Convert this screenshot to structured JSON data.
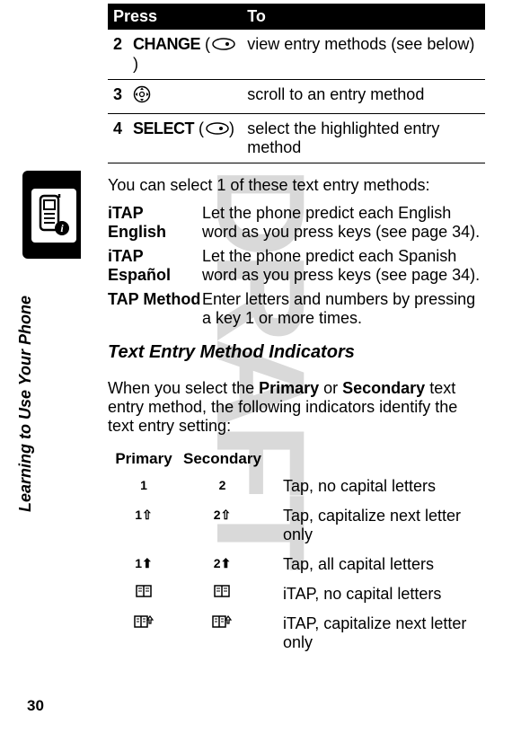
{
  "watermark": "DRAFT",
  "sidebar_label": "Learning to Use Your Phone",
  "page_number": "30",
  "press_to_table": {
    "header_press": "Press",
    "header_to": "To",
    "rows": [
      {
        "step": "2",
        "key_label": "CHANGE",
        "key_suffix_open": "(",
        "key_suffix_close": ")",
        "action": "view entry methods (see below)"
      },
      {
        "step": "3",
        "key_label": "",
        "action": "scroll to an entry method"
      },
      {
        "step": "4",
        "key_label": "SELECT",
        "key_suffix_open": "(",
        "key_suffix_close": ")",
        "action": "select the highlighted entry method"
      }
    ]
  },
  "intro_text": "You can select 1 of these text entry methods:",
  "methods": [
    {
      "name": "iTAP English",
      "desc": "Let the phone predict each English word as you press keys (see page 34)."
    },
    {
      "name": "iTAP Español",
      "desc": "Let the phone predict each Spanish word as you press keys (see page 34)."
    },
    {
      "name": "TAP Method",
      "desc": "Enter letters and numbers by pressing a key 1 or more times."
    }
  ],
  "subhead": "Text Entry Method Indicators",
  "body_part1": "When you select the ",
  "body_primary": "Primary",
  "body_part2": " or ",
  "body_secondary": "Secondary",
  "body_part3": " text entry method, the following indicators identify the text entry setting:",
  "indicator_headers": {
    "primary": "Primary",
    "secondary": "Secondary"
  },
  "indicator_rows": [
    {
      "desc": "Tap, no capital letters"
    },
    {
      "desc": "Tap, capitalize next letter only"
    },
    {
      "desc": "Tap, all capital letters"
    },
    {
      "desc": "iTAP, no capital letters"
    },
    {
      "desc": "iTAP, capitalize next letter only"
    }
  ]
}
